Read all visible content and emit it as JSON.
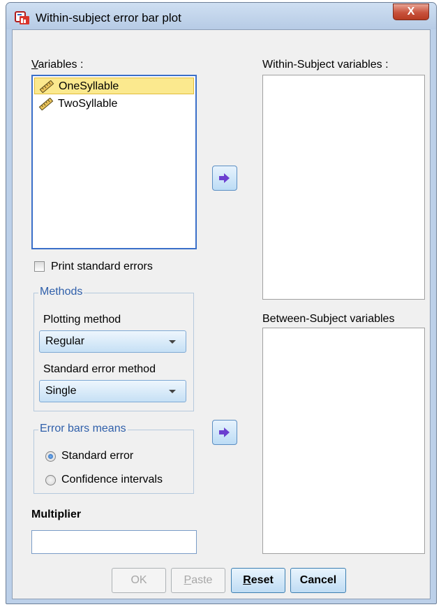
{
  "window": {
    "title": "Within-subject error bar plot",
    "close_label": "X"
  },
  "variables": {
    "label_first": "V",
    "label_rest": "ariables :",
    "items": [
      {
        "label": "OneSyllable",
        "icon": "ruler-icon",
        "selected": true
      },
      {
        "label": "TwoSyllable",
        "icon": "ruler-icon",
        "selected": false
      }
    ]
  },
  "within_subject": {
    "label": "Within-Subject variables :"
  },
  "between_subject": {
    "label": "Between-Subject variables"
  },
  "print_standard_errors": {
    "label": "Print standard errors",
    "checked": false
  },
  "methods": {
    "title": "Methods",
    "plotting_method_label": "Plotting method",
    "plotting_method_value": "Regular",
    "se_method_label": "Standard error method",
    "se_method_value": "Single"
  },
  "error_bars": {
    "title": "Error bars means",
    "options": [
      {
        "label": "Standard error",
        "checked": true
      },
      {
        "label": "Confidence intervals",
        "checked": false
      }
    ]
  },
  "multiplier": {
    "label": "Multiplier",
    "value": ""
  },
  "buttons": {
    "ok": "OK",
    "paste_first": "P",
    "paste_rest": "aste",
    "reset_first": "R",
    "reset_rest": "eset",
    "cancel": "Cancel"
  },
  "colors": {
    "accent": "#3a6fc9",
    "group_title": "#2f5faa",
    "selection": "#fbe98e"
  }
}
